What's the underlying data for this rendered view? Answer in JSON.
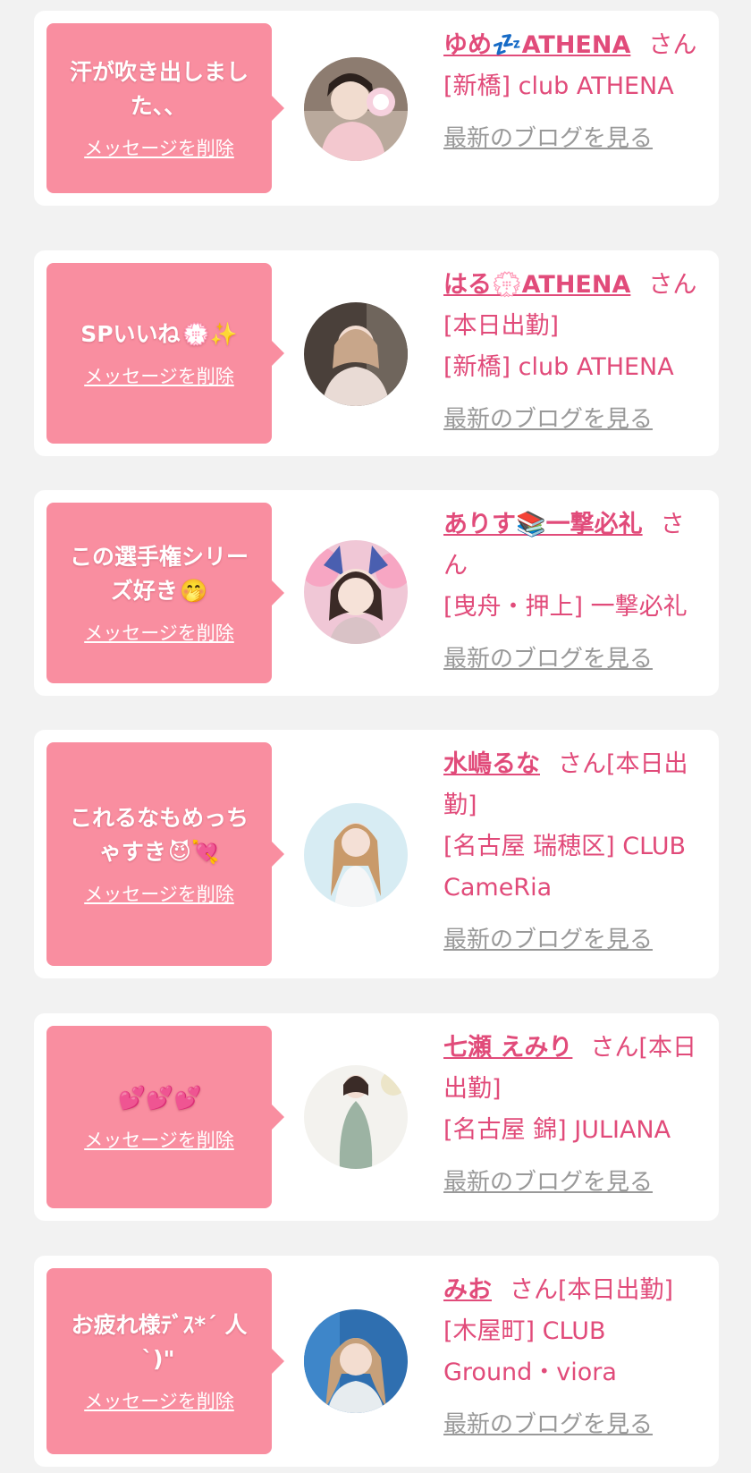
{
  "colors": {
    "background": "#f2f2f2",
    "card": "#ffffff",
    "bubble": "#f98ea0",
    "accent_pink": "#e14b7a",
    "link_gray": "#999999"
  },
  "delete_label": "メッセージを削除",
  "blog_label": "最新のブログを見る",
  "messages": [
    {
      "message": "汗が吹き出しました、、",
      "message_emoji": "",
      "cast_name": "ゆめ💤ATHENA",
      "name_suffix": "さん",
      "shop": "[新橋] club ATHENA"
    },
    {
      "message": "SPいいね",
      "message_emoji": "💮✨",
      "cast_name": "はる💮ATHENA",
      "name_suffix": "さん[本日出勤]",
      "shop": "[新橋] club ATHENA"
    },
    {
      "message": "この選手権シリーズ好き",
      "message_emoji": "🤭",
      "cast_name": "ありす📚一撃必礼",
      "name_suffix": "さん",
      "shop": "[曳舟・押上] 一撃必礼"
    },
    {
      "message": "これるなもめっちゃすき",
      "message_emoji": "😈💘",
      "cast_name": "水嶋るな",
      "name_suffix": "さん[本日出勤]",
      "shop": "[名古屋 瑞穂区] CLUB CameRia"
    },
    {
      "message": "",
      "message_emoji": "💕💕💕",
      "cast_name": "七瀬 えみり",
      "name_suffix": "さん[本日出勤]",
      "shop": "[名古屋 錦] JULIANA"
    },
    {
      "message": "お疲れ様ﾃﾞｽ*´ 人`)\"",
      "message_emoji": "",
      "cast_name": "みお",
      "name_suffix": "さん[本日出勤]",
      "shop": "[木屋町] CLUB Ground・viora"
    }
  ]
}
